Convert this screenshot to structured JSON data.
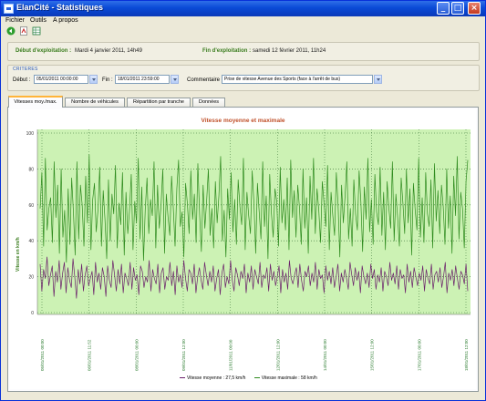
{
  "window": {
    "title": "ElanCité - Statistiques"
  },
  "menu": [
    "Fichier",
    "Outils",
    "A propos"
  ],
  "info": {
    "start_label": "Début d'exploitation :",
    "start_value": "Mardi 4 janvier 2011, 14h49",
    "end_label": "Fin d'exploitation :",
    "end_value": "samedi 12 février 2011, 11h24"
  },
  "criteria": {
    "title": "CRITERES",
    "start_label": "Début :",
    "start_value": "05/01/2011 00:00:00",
    "end_label": "Fin :",
    "end_value": "18/01/2011 23:59:00",
    "comment_label": "Commentaire :",
    "comment_value": "Prise de vitesse Avenue des Sports (face à l'arrêt de bus)"
  },
  "tabs": [
    {
      "label": "Vitesses moy./max."
    },
    {
      "label": "Nombre de véhicules"
    },
    {
      "label": "Répartition par tranche"
    },
    {
      "label": "Données"
    }
  ],
  "colors": {
    "max": "#2e8b1e",
    "moy": "#6a1f6a",
    "plot_bg": "#ccf2b4",
    "grid": "#2f6b2f",
    "axis_tick": "#2e7d32"
  },
  "chart_data": {
    "type": "line",
    "title": "Vitesse moyenne et maximale",
    "ylabel": "Vitesse en km/h",
    "ylim": [
      0,
      100
    ],
    "yticks": [
      0,
      20,
      40,
      60,
      80,
      100
    ],
    "xticks": [
      "05/01/2011 00:00",
      "06/01/2011 11:52",
      "08/01/2011 00:00",
      "09/01/2011 12:00",
      "11/01/2011 00:00",
      "12/01/2011 12:00",
      "14/01/2011 00:00",
      "15/01/2011 12:00",
      "17/01/2011 00:00",
      "18/01/2011 12:00"
    ],
    "legend": [
      "Vitesse moyenne : 27,5 km/h",
      "Vitesse maximale : 58 km/h"
    ],
    "series": [
      {
        "name": "Vitesse maximale",
        "values": [
          58,
          78,
          37,
          86,
          46,
          58,
          64,
          39,
          84,
          53,
          71,
          33,
          80,
          42,
          57,
          28,
          69,
          38,
          75,
          56,
          32,
          84,
          41,
          71,
          60,
          37,
          76,
          50,
          88,
          35,
          63,
          72,
          45,
          57,
          81,
          37,
          68,
          52,
          30,
          74,
          40,
          66,
          55,
          82,
          36,
          61,
          49,
          78,
          32,
          67,
          44,
          57,
          77,
          35,
          62,
          50,
          86,
          41,
          70,
          29,
          58,
          75,
          44,
          63,
          54,
          84,
          36,
          71,
          47,
          60,
          80,
          33,
          66,
          53,
          43,
          76,
          58,
          37,
          69,
          85,
          48,
          56,
          31,
          72,
          61,
          44,
          79,
          52,
          66,
          39,
          83,
          55,
          34,
          71,
          47,
          62,
          80,
          43,
          58,
          36,
          73,
          50,
          65,
          87,
          40,
          57,
          31,
          69,
          52,
          78,
          45,
          63,
          38,
          74,
          59,
          49,
          86,
          35,
          67,
          54,
          44,
          79,
          61,
          33,
          72,
          56,
          41,
          84,
          48,
          65,
          30,
          77,
          55,
          42,
          69,
          62,
          37,
          81,
          50,
          63,
          46,
          75,
          35,
          85,
          53,
          68,
          42,
          71,
          58,
          38,
          80,
          47,
          64,
          33,
          76,
          52,
          86,
          44,
          69,
          57,
          39,
          73,
          61,
          48,
          82,
          35,
          67,
          54,
          43,
          78,
          60,
          31,
          71,
          50,
          65,
          84,
          41,
          58,
          37,
          74,
          55,
          46,
          79,
          62,
          34,
          70,
          52,
          86,
          45,
          63,
          38,
          77,
          56,
          49,
          81,
          43,
          67,
          35,
          73,
          58,
          47,
          84,
          40,
          66,
          53,
          37,
          75,
          61,
          44,
          80,
          50,
          69,
          32,
          72,
          57,
          46,
          86,
          42,
          64,
          39,
          78,
          55,
          48,
          74,
          36,
          83,
          51,
          68,
          44,
          71,
          59,
          38,
          80,
          47,
          65,
          33,
          76,
          54,
          87,
          41,
          67,
          58,
          36,
          73,
          85
        ]
      },
      {
        "name": "Vitesse moyenne",
        "values": [
          27,
          12,
          24,
          19,
          31,
          15,
          21,
          26,
          9,
          23,
          17,
          29,
          13,
          22,
          28,
          11,
          25,
          18,
          14,
          30,
          20,
          8,
          24,
          16,
          27,
          12,
          21,
          26,
          15,
          19,
          23,
          10,
          28,
          17,
          22,
          13,
          25,
          20,
          9,
          26,
          18,
          14,
          29,
          21,
          12,
          24,
          16,
          27,
          11,
          22,
          19,
          15,
          28,
          13,
          25,
          18,
          21,
          10,
          26,
          23,
          14,
          20,
          17,
          29,
          12,
          24,
          19,
          16,
          27,
          11,
          22,
          25,
          13,
          20,
          18,
          28,
          15,
          23,
          10,
          26,
          17,
          21,
          14,
          29,
          19,
          12,
          24,
          22,
          16,
          27,
          11,
          20,
          25,
          18,
          13,
          28,
          21,
          15,
          23,
          17,
          26,
          12,
          19,
          24,
          10,
          22,
          27,
          14,
          20,
          16,
          29,
          18,
          12,
          25,
          21,
          15,
          23,
          19,
          27,
          11,
          22,
          17,
          26,
          13,
          24,
          20,
          16,
          28,
          14,
          21,
          19,
          25,
          12,
          27,
          18,
          23,
          15,
          20,
          26,
          11,
          24,
          17,
          22,
          13,
          29,
          19,
          16,
          21,
          25,
          14,
          27,
          18,
          12,
          23,
          20,
          26,
          15,
          22,
          17,
          28,
          13,
          24,
          19,
          21,
          11,
          26,
          18,
          23,
          16,
          25,
          14,
          20,
          27,
          12,
          22,
          17,
          24,
          19,
          13,
          28,
          21,
          15,
          25,
          18,
          23,
          11,
          26,
          20,
          16,
          22,
          14,
          27,
          19,
          24,
          13,
          21,
          17,
          25,
          12,
          23,
          20,
          15,
          28,
          18,
          22,
          16,
          26,
          13,
          24,
          19,
          21,
          11,
          27,
          17,
          23,
          14,
          25,
          20,
          15,
          22,
          18,
          26,
          12,
          24,
          19,
          16,
          27,
          13,
          21,
          23,
          17,
          25,
          14,
          20,
          28,
          11,
          22,
          18,
          24,
          15,
          26,
          19,
          13,
          23,
          21,
          16,
          27,
          12
        ]
      }
    ]
  }
}
